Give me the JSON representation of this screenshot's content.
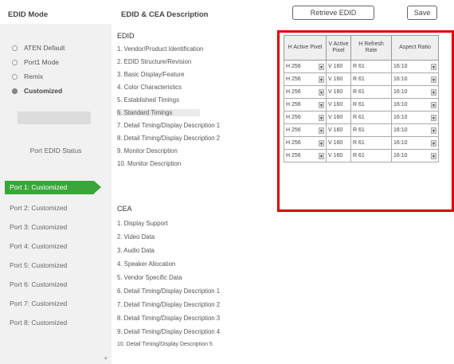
{
  "header": {
    "edid_mode": "EDID Mode",
    "edid_cea_desc": "EDID & CEA Description",
    "retrieve_label": "Retrieve EDID",
    "save_label": "Save"
  },
  "mode_options": [
    {
      "label": "ATEN Default",
      "selected": false
    },
    {
      "label": "Port1 Mode",
      "selected": false
    },
    {
      "label": "Remix",
      "selected": false
    },
    {
      "label": "Customized",
      "selected": true
    }
  ],
  "port_edid_status": "Port EDID Status",
  "ports": [
    {
      "label": "Port 1: Customized",
      "active": true
    },
    {
      "label": "Port 2: Customized",
      "active": false
    },
    {
      "label": "Port 3: Customized",
      "active": false
    },
    {
      "label": "Port 4: Customized",
      "active": false
    },
    {
      "label": "Port 5: Customized",
      "active": false
    },
    {
      "label": "Port 6: Customized",
      "active": false
    },
    {
      "label": "Port 7: Customized",
      "active": false
    },
    {
      "label": "Port 8: Customized",
      "active": false
    }
  ],
  "edid": {
    "title": "EDID",
    "items": [
      "1. Vendor/Product Identification",
      "2. EDID Structure/Revision",
      "3. Basic Display/Feature",
      "4. Color Characteristics",
      "5. Established Timings",
      "6. Standard Timings",
      "7. Detail Timing/Display Description 1",
      "8. Detail Timing/Display Description 2",
      "9. Monitor Description",
      "10. Monitor Description"
    ],
    "highlighted_index": 5
  },
  "cea": {
    "title": "CEA",
    "items": [
      "1. Display Support",
      "2. Video Data",
      "3. Audio Data",
      "4. Speaker Allocation",
      "5. Vendor Specific Data",
      "6. Detail Timing/Display Description 1",
      "7. Detail Timing/Display Description 2",
      "8. Detail Timing/Display Description 3",
      "9. Detail Timing/Display Description 4",
      "10. Detail Timing/Display Description 5"
    ]
  },
  "table": {
    "headers": [
      "H Active Pixel",
      "V Active Pixel",
      "H Refresh Rate",
      "Aspect Ratio"
    ],
    "rows": [
      [
        "H 256",
        "V 160",
        "R 61",
        "16:10"
      ],
      [
        "H 256",
        "V 160",
        "R 61",
        "16:10"
      ],
      [
        "H 256",
        "V 160",
        "R 61",
        "16:10"
      ],
      [
        "H 256",
        "V 160",
        "R 61",
        "16:10"
      ],
      [
        "H 256",
        "V 160",
        "R 61",
        "16:10"
      ],
      [
        "H 256",
        "V 160",
        "R 61",
        "16:10"
      ],
      [
        "H 256",
        "V 160",
        "R 61",
        "16:10"
      ],
      [
        "H 256",
        "V 160",
        "R 61",
        "16:10"
      ]
    ],
    "highlight_color": "#e00000"
  },
  "colors": {
    "active_port": "#3aa63a"
  }
}
